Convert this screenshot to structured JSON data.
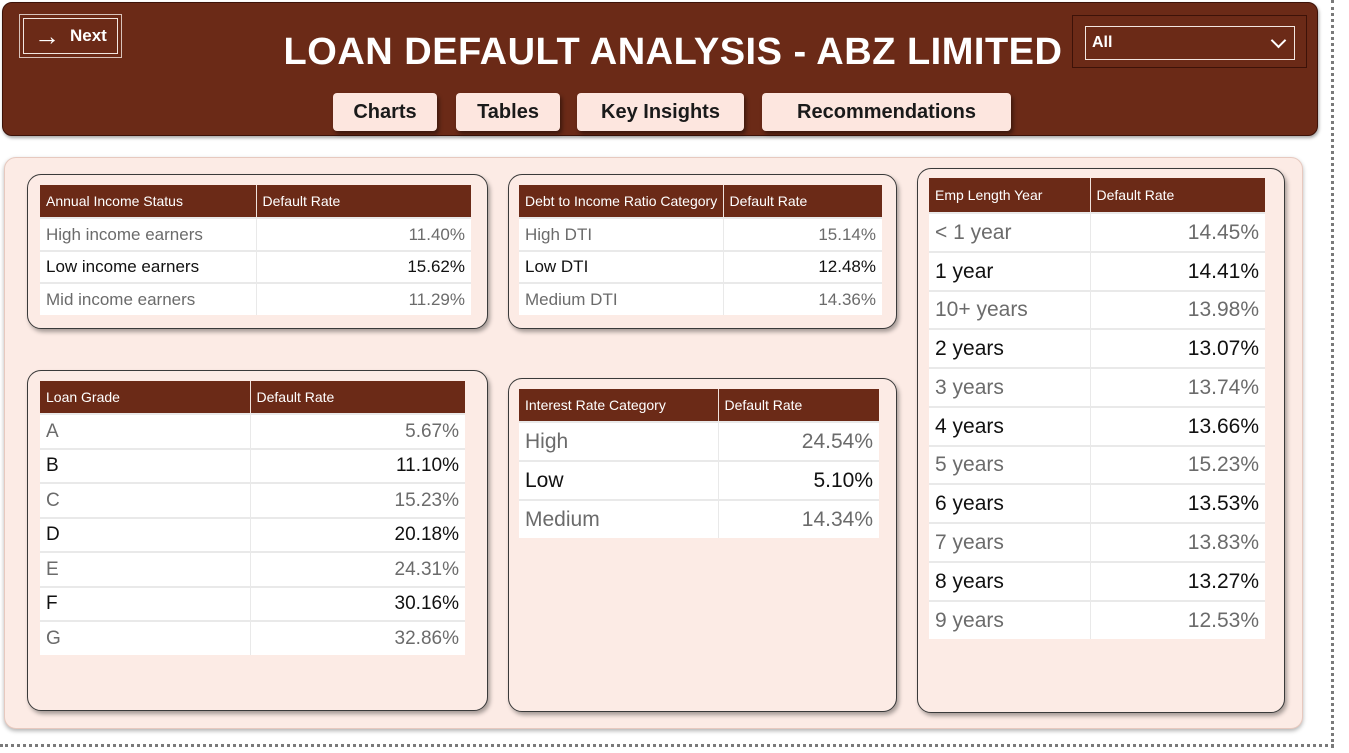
{
  "header": {
    "title": "LOAN DEFAULT ANALYSIS - ABZ LIMITED",
    "next_label": "Next",
    "filter_value": "All",
    "nav": [
      "Charts",
      "Tables",
      "Key Insights",
      "Recommendations"
    ]
  },
  "tables": {
    "income": {
      "col1": "Annual Income Status",
      "col2": "Default Rate",
      "rows": [
        {
          "label": "High income earners",
          "value": "11.40%"
        },
        {
          "label": "Low income earners",
          "value": "15.62%"
        },
        {
          "label": "Mid income earners",
          "value": "11.29%"
        }
      ]
    },
    "dti": {
      "col1": "Debt to Income Ratio Category",
      "col2": "Default Rate",
      "rows": [
        {
          "label": "High DTI",
          "value": "15.14%"
        },
        {
          "label": "Low DTI",
          "value": "12.48%"
        },
        {
          "label": "Medium DTI",
          "value": "14.36%"
        }
      ]
    },
    "grade": {
      "col1": "Loan Grade",
      "col2": "Default Rate",
      "rows": [
        {
          "label": "A",
          "value": "5.67%"
        },
        {
          "label": "B",
          "value": "11.10%"
        },
        {
          "label": "C",
          "value": "15.23%"
        },
        {
          "label": "D",
          "value": "20.18%"
        },
        {
          "label": "E",
          "value": "24.31%"
        },
        {
          "label": "F",
          "value": "30.16%"
        },
        {
          "label": "G",
          "value": "32.86%"
        }
      ]
    },
    "interest": {
      "col1": "Interest Rate Category",
      "col2": "Default Rate",
      "rows": [
        {
          "label": "High",
          "value": "24.54%"
        },
        {
          "label": "Low",
          "value": "5.10%"
        },
        {
          "label": "Medium",
          "value": "14.34%"
        }
      ]
    },
    "emp": {
      "col1": "Emp Length Year",
      "col2": "Default Rate",
      "rows": [
        {
          "label": "< 1 year",
          "value": "14.45%"
        },
        {
          "label": "1 year",
          "value": "14.41%"
        },
        {
          "label": "10+ years",
          "value": "13.98%"
        },
        {
          "label": "2 years",
          "value": "13.07%"
        },
        {
          "label": "3 years",
          "value": "13.74%"
        },
        {
          "label": "4 years",
          "value": "13.66%"
        },
        {
          "label": "5 years",
          "value": "15.23%"
        },
        {
          "label": "6 years",
          "value": "13.53%"
        },
        {
          "label": "7 years",
          "value": "13.83%"
        },
        {
          "label": "8 years",
          "value": "13.27%"
        },
        {
          "label": "9 years",
          "value": "12.53%"
        }
      ]
    }
  }
}
